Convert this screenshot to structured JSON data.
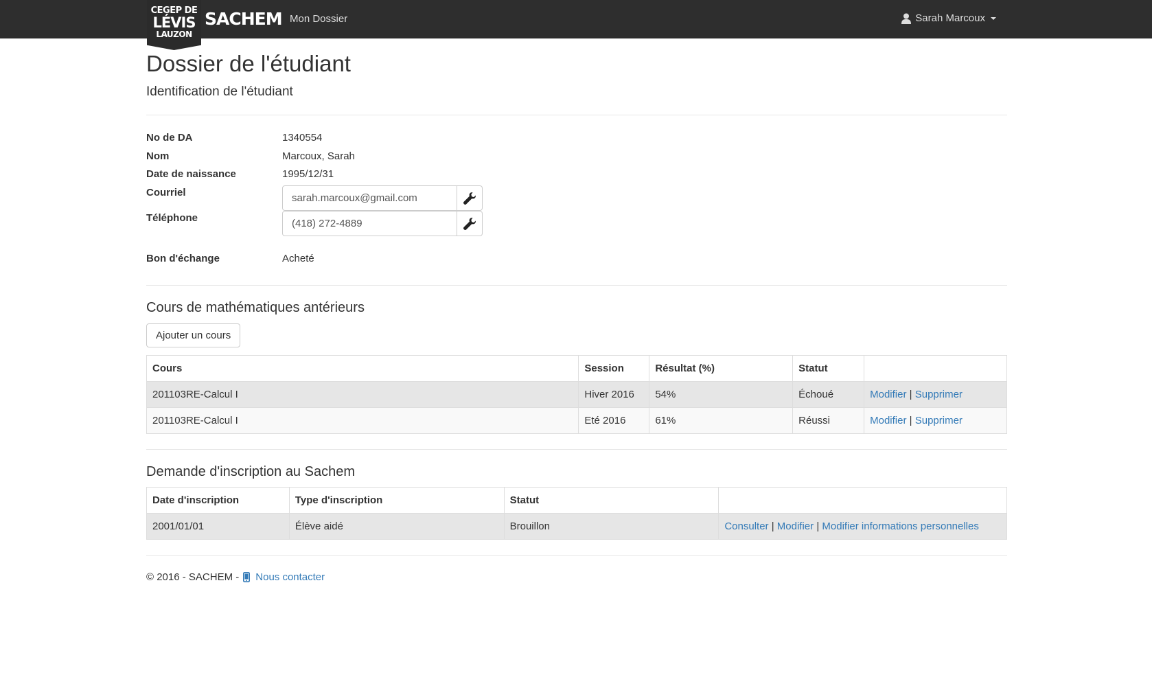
{
  "navbar": {
    "logo": {
      "line1": "CEGEP DE",
      "line2": "LÉVIS",
      "line3": "LAUZON"
    },
    "brand": "SACHEM",
    "nav_link": "Mon Dossier",
    "user_name": "Sarah Marcoux",
    "user_icon": "user-icon"
  },
  "page": {
    "title": "Dossier de l'étudiant",
    "subtitle": "Identification de l'étudiant"
  },
  "identification": {
    "da_label": "No de DA",
    "da_value": "1340554",
    "name_label": "Nom",
    "name_value": "Marcoux, Sarah",
    "dob_label": "Date de naissance",
    "dob_value": "1995/12/31",
    "email_label": "Courriel",
    "email_value": "sarah.marcoux@gmail.com",
    "phone_label": "Téléphone",
    "phone_value": "(418) 272-4889",
    "voucher_label": "Bon d'échange",
    "voucher_value": "Acheté",
    "edit_icon": "wrench-icon"
  },
  "courses": {
    "heading": "Cours de mathématiques antérieurs",
    "add_button": "Ajouter un cours",
    "columns": [
      "Cours",
      "Session",
      "Résultat (%)",
      "Statut",
      ""
    ],
    "rows": [
      {
        "course": "201103RE-Calcul I",
        "session": "Hiver 2016",
        "result": "54%",
        "status": "Échoué",
        "edit": "Modifier",
        "delete": "Supprimer"
      },
      {
        "course": "201103RE-Calcul I",
        "session": "Eté 2016",
        "result": "61%",
        "status": "Réussi",
        "edit": "Modifier",
        "delete": "Supprimer"
      }
    ],
    "separator": "|"
  },
  "registration": {
    "heading": "Demande d'inscription au Sachem",
    "columns": [
      "Date d'inscription",
      "Type d'inscription",
      "Statut",
      ""
    ],
    "rows": [
      {
        "date": "2001/01/01",
        "type": "Élève aidé",
        "status": "Brouillon",
        "view": "Consulter",
        "edit": "Modifier",
        "edit_personal": "Modifier informations personnelles"
      }
    ],
    "separator": "|"
  },
  "footer": {
    "copyright": "© 2016 - SACHEM -",
    "contact": "Nous contacter",
    "icon": "mobile-phone-icon"
  },
  "colors": {
    "navbar_bg": "#2e2e2e",
    "link": "#337ab7",
    "row_odd": "#e6e6e6",
    "row_even": "#f9f9f9"
  }
}
